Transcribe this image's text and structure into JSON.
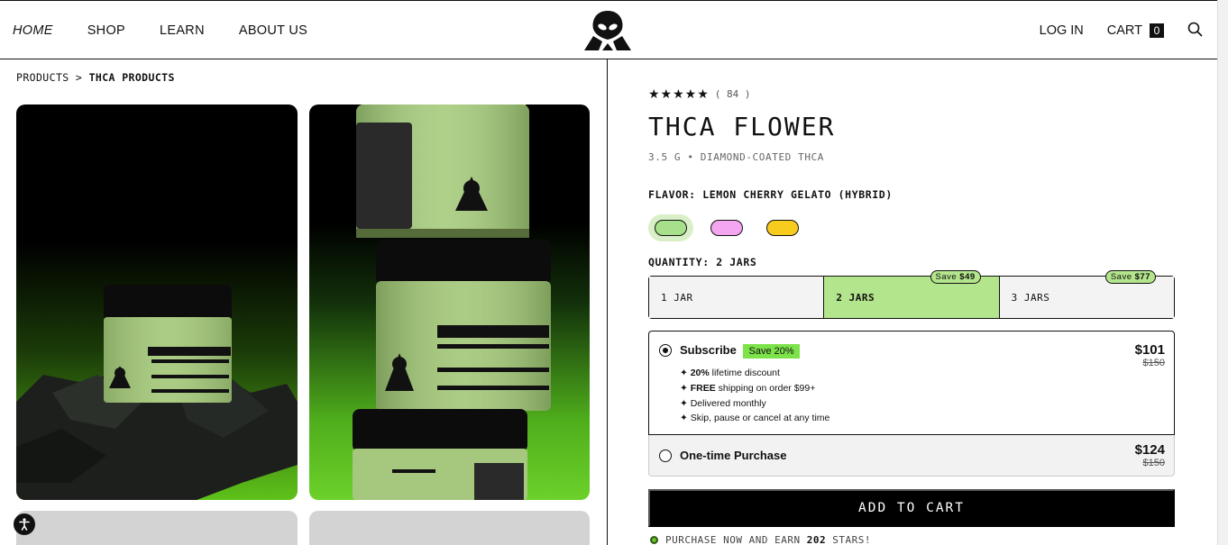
{
  "header": {
    "nav_left": [
      "HOME",
      "SHOP",
      "LEARN",
      "ABOUT US"
    ],
    "login_label": "LOG IN",
    "cart_label": "CART",
    "cart_count": "0",
    "logo_icon": "alien-logo-icon",
    "search_icon": "search-icon"
  },
  "breadcrumb": {
    "parent": "PRODUCTS",
    "separator": ">",
    "current": "THCA PRODUCTS"
  },
  "gallery": {
    "images": [
      "thca-jar-on-rock-image",
      "stacked-thca-jars-image"
    ]
  },
  "product": {
    "stars": "★★★★★",
    "review_count": "( 84 )",
    "title": "THCA FLOWER",
    "subtitle": "3.5 G • DIAMOND-COATED THCA",
    "flavor_label": "FLAVOR: LEMON CHERRY GELATO (HYBRID)",
    "swatches": [
      {
        "color": "#a6e08a",
        "selected": true
      },
      {
        "color": "#f4a6f0",
        "selected": false
      },
      {
        "color": "#f7cc1e",
        "selected": false
      }
    ],
    "quantity_label": "QUANTITY: 2 JARS",
    "quantity_options": [
      {
        "label": "1 JAR",
        "badge_prefix": "",
        "badge_amount": ""
      },
      {
        "label": "2 JARS",
        "badge_prefix": "Save ",
        "badge_amount": "$49"
      },
      {
        "label": "3 JARS",
        "badge_prefix": "Save ",
        "badge_amount": "$77"
      }
    ]
  },
  "plans": {
    "subscribe": {
      "title": "Subscribe",
      "badge": "Save 20%",
      "price": "$101",
      "was": "$150",
      "benefits": [
        {
          "bold": "20%",
          "text": " lifetime discount"
        },
        {
          "bold": "FREE",
          "text": " shipping on order $99+"
        },
        {
          "bold": "",
          "text": "Delivered monthly"
        },
        {
          "bold": "",
          "text": "Skip, pause or cancel at any time"
        }
      ]
    },
    "one_time": {
      "title": "One-time Purchase",
      "price": "$124",
      "was": "$150"
    }
  },
  "cta": {
    "add_to_cart": "ADD TO CART",
    "earn_prefix": "PURCHASE NOW AND EARN",
    "earn_amount": "202",
    "earn_suffix": "STARS!"
  },
  "colors": {
    "accent_green": "#b3e58c",
    "save_green": "#7de34a",
    "black": "#000000"
  }
}
